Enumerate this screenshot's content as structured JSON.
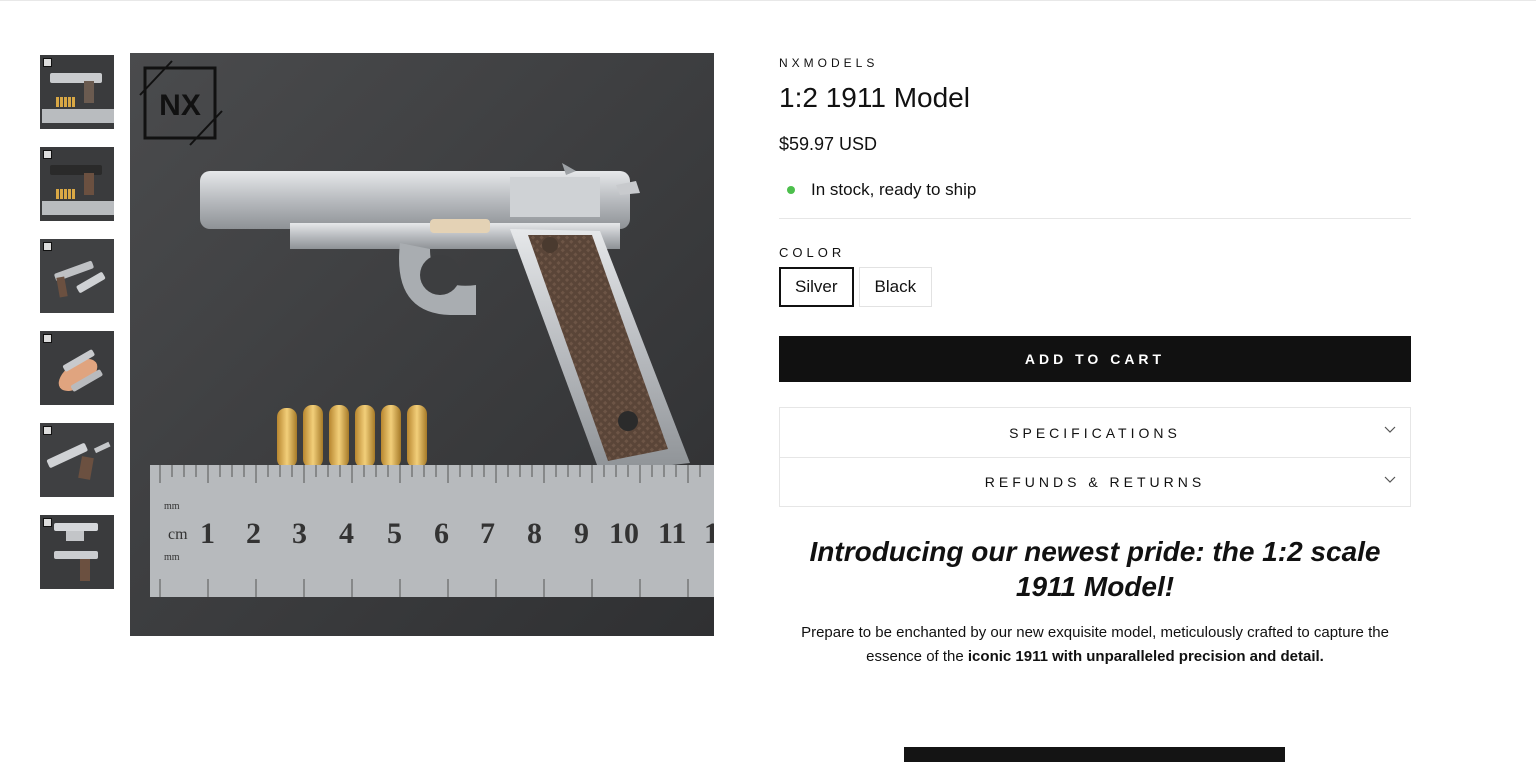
{
  "product": {
    "vendor": "NXMODELS",
    "title": "1:2 1911 Model",
    "price": "$59.97 USD",
    "stock_text": "In stock, ready to ship",
    "stock_color": "#4cbf4c"
  },
  "variant": {
    "label": "COLOR",
    "options": [
      "Silver",
      "Black"
    ],
    "selected": "Silver"
  },
  "cart": {
    "add_label": "ADD TO CART"
  },
  "accordion": {
    "specifications": "SPECIFICATIONS",
    "refunds": "REFUNDS & RETURNS"
  },
  "description": {
    "heading": "Introducing our newest pride: the 1:2 scale 1911 Model!",
    "text_start": "Prepare to be enchanted by our new exquisite model, meticulously crafted to capture the essence of the ",
    "text_bold": "iconic 1911 with unparalleled precision and detail."
  },
  "gallery": {
    "logo_text": "NX",
    "ruler_labels": [
      "mm",
      "cm",
      "mm"
    ],
    "ruler_numbers": [
      "1",
      "2",
      "3",
      "4",
      "5",
      "6",
      "7",
      "8",
      "9",
      "10",
      "11",
      "1"
    ],
    "thumbnail_count": 6,
    "active_thumbnail": 1
  },
  "colors": {
    "accent": "#111111",
    "background": "#ffffff",
    "image_background": "#3d3e40"
  }
}
